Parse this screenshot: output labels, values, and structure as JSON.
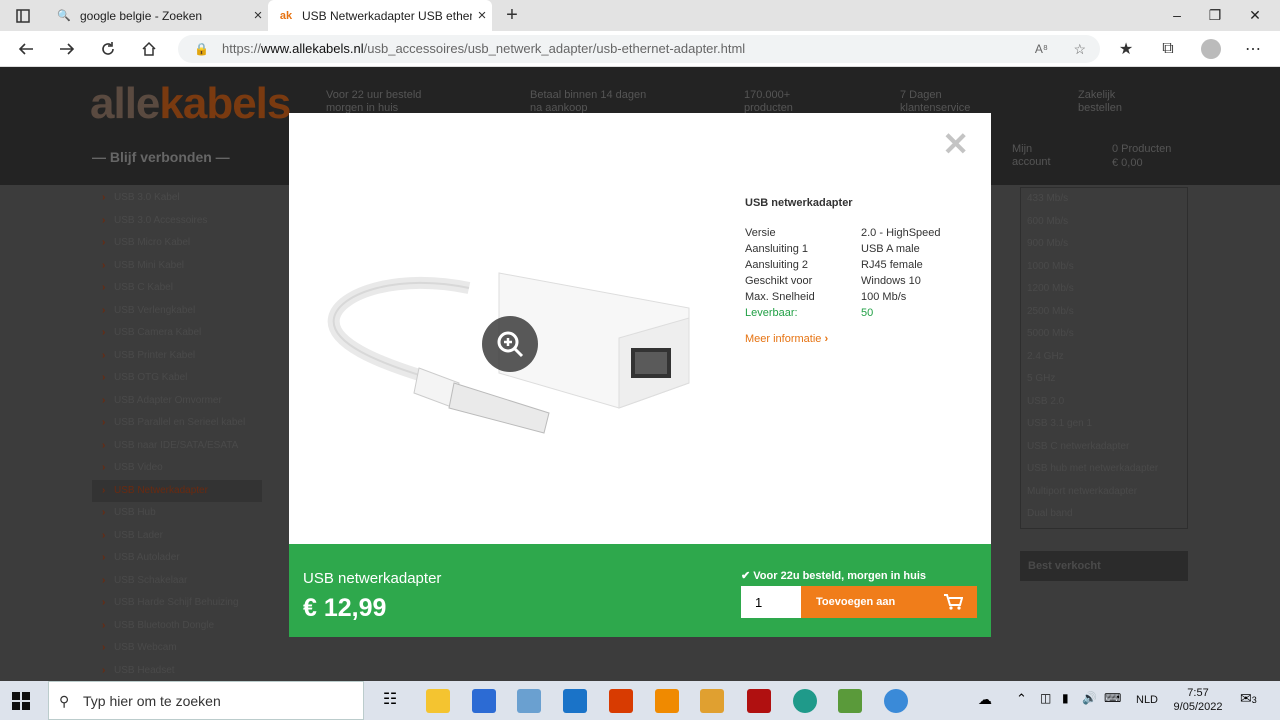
{
  "browser": {
    "tabs": [
      {
        "title": "google belgie - Zoeken"
      },
      {
        "title": "USB Netwerkadapter USB ethern"
      }
    ],
    "url_prefix": "https://",
    "url_domain": "www.allekabels.nl",
    "url_path": "/usb_accessoires/usb_netwerk_adapter/usb-ethernet-adapter.html"
  },
  "site": {
    "logo_a": "alle",
    "logo_b": "kabels",
    "slogan": "— Blijf verbonden —",
    "usps": [
      "Voor 22 uur besteld morgen in huis",
      "Betaal binnen 14 dagen na aankoop",
      "170.000+ producten",
      "7 Dagen klantenservice",
      "Zakelijk bestellen"
    ],
    "account": "Mijn account",
    "cart_count": "0 Producten",
    "cart_total": "€ 0,00",
    "left_nav": [
      "USB 3.0 Kabel",
      "USB 3.0 Accessoires",
      "USB Micro Kabel",
      "USB Mini Kabel",
      "USB C Kabel",
      "USB Verlengkabel",
      "USB Camera Kabel",
      "USB Printer Kabel",
      "USB OTG Kabel",
      "USB Adapter Omvormer",
      "USB Parallel en Serieel kabel",
      "USB naar IDE/SATA/ESATA",
      "USB Video",
      "USB Netwerkadapter",
      "USB Hub",
      "USB Lader",
      "USB Autolader",
      "USB Schakelaar",
      "USB Harde Schijf Behuizing",
      "USB Bluetooth Dongle",
      "USB Webcam",
      "USB Headset"
    ],
    "right_nav": [
      "433 Mb/s",
      "600 Mb/s",
      "900 Mb/s",
      "1000 Mb/s",
      "1200 Mb/s",
      "2500 Mb/s",
      "5000 Mb/s",
      "2.4 GHz",
      "5 GHz",
      "USB 2.0",
      "USB 3.1 gen 1",
      "USB C netwerkadapter",
      "USB hub met netwerkadapter",
      "Multiport netwerkadapter",
      "Dual band"
    ],
    "best_seller": "Best verkocht"
  },
  "modal": {
    "title": "USB netwerkadapter",
    "specs": [
      {
        "k": "Versie",
        "v": "2.0 - HighSpeed"
      },
      {
        "k": "Aansluiting 1",
        "v": "USB A male"
      },
      {
        "k": "Aansluiting 2",
        "v": "RJ45 female"
      },
      {
        "k": "Geschikt voor",
        "v": "Windows 10"
      },
      {
        "k": "Max. Snelheid",
        "v": "100 Mb/s"
      }
    ],
    "stock_label": "Leverbaar:",
    "stock_value": "50",
    "more_info": "Meer informatie",
    "product_name": "USB netwerkadapter",
    "price": "€ 12,99",
    "delivery": "Voor 22u besteld, morgen in huis",
    "quantity": "1",
    "add_button": "Toevoegen aan"
  },
  "taskbar": {
    "search_placeholder": "Typ hier om te zoeken",
    "language": "NLD",
    "time": "7:57",
    "date": "9/05/2022",
    "notif_count": "3"
  },
  "colors": {
    "green": "#2ea84c",
    "orange": "#f07d1a",
    "link_orange": "#e67312"
  }
}
